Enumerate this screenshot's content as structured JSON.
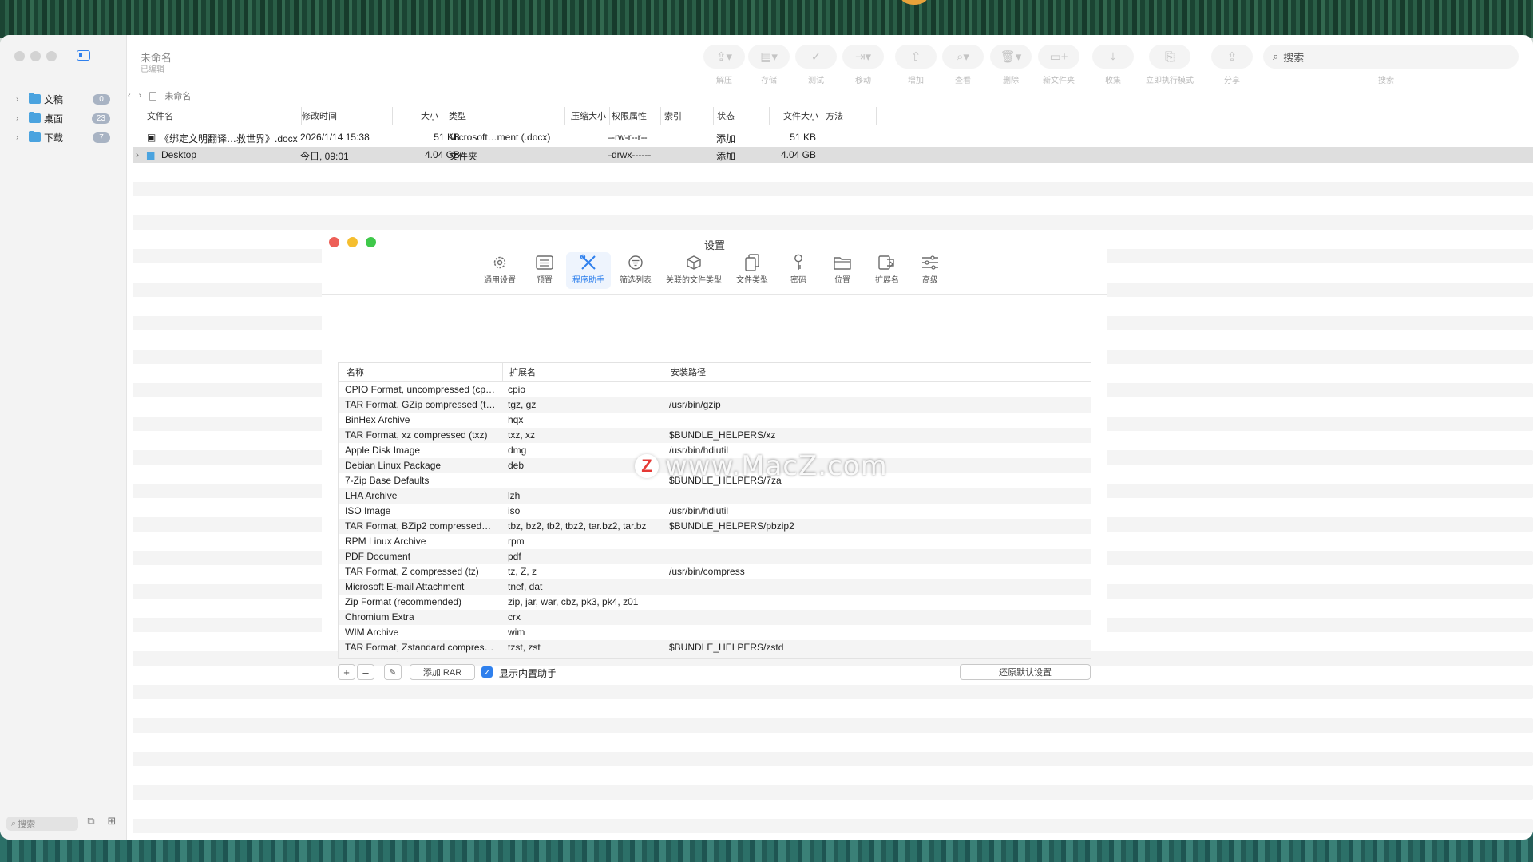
{
  "app": {
    "title": "未命名",
    "subtitle": "已编辑"
  },
  "sidebar": {
    "items": [
      {
        "label": "文稿",
        "count": "0"
      },
      {
        "label": "桌面",
        "count": "23"
      },
      {
        "label": "下载",
        "count": "7"
      }
    ],
    "search_placeholder": "搜索"
  },
  "toolbar": [
    {
      "label": "解压",
      "icon": "extract-icon"
    },
    {
      "label": "存储",
      "icon": "archive-icon"
    },
    {
      "label": "测试",
      "icon": "test-icon"
    },
    {
      "label": "移动",
      "icon": "move-icon"
    },
    {
      "label": "增加",
      "icon": "add-icon"
    },
    {
      "label": "查看",
      "icon": "view-icon"
    },
    {
      "label": "删除",
      "icon": "trash-icon"
    },
    {
      "label": "新文件夹",
      "icon": "new-folder-icon"
    },
    {
      "label": "收集",
      "icon": "collect-icon"
    },
    {
      "label": "立即执行模式",
      "icon": "run-mode-icon"
    },
    {
      "label": "分享",
      "icon": "share-icon"
    }
  ],
  "search": {
    "placeholder": "搜索",
    "label": "搜索"
  },
  "breadcrumb": {
    "item": "未命名"
  },
  "file_table": {
    "columns": [
      "文件名",
      "修改时间",
      "大小",
      "类型",
      "压缩大小",
      "权限属性",
      "索引",
      "状态",
      "文件大小",
      "方法"
    ],
    "rows": [
      {
        "name": "《绑定文明翻译…救世界》.docx",
        "modified": "2026/1/14 15:38",
        "size": "51 KB",
        "type": "Microsoft…ment (.docx)",
        "compressed": "–",
        "permissions": "-rw-r--r--",
        "index": "",
        "status": "添加",
        "file_size": "51 KB",
        "method": ""
      },
      {
        "name": "Desktop",
        "modified": "今日, 09:01",
        "size": "4.04 GB",
        "type": "文件夹",
        "compressed": "–",
        "permissions": "drwx------",
        "index": "",
        "status": "添加",
        "file_size": "4.04 GB",
        "method": ""
      }
    ]
  },
  "dialog": {
    "title": "设置",
    "tabs": [
      {
        "label": "通用设置",
        "icon": "gear-icon"
      },
      {
        "label": "预置",
        "icon": "list-icon"
      },
      {
        "label": "程序助手",
        "icon": "tools-icon"
      },
      {
        "label": "筛选列表",
        "icon": "filter-icon"
      },
      {
        "label": "关联的文件类型",
        "icon": "box-icon"
      },
      {
        "label": "文件类型",
        "icon": "documents-icon"
      },
      {
        "label": "密码",
        "icon": "key-icon"
      },
      {
        "label": "位置",
        "icon": "folder-icon"
      },
      {
        "label": "扩展名",
        "icon": "extension-icon"
      },
      {
        "label": "高级",
        "icon": "sliders-icon"
      }
    ],
    "active_tab": "程序助手",
    "table": {
      "columns": [
        "名称",
        "扩展名",
        "安装路径"
      ],
      "rows": [
        {
          "name": "CPIO Format, uncompressed (cp…",
          "ext": "cpio",
          "path": ""
        },
        {
          "name": "TAR Format, GZip compressed (t…",
          "ext": "tgz, gz",
          "path": "/usr/bin/gzip"
        },
        {
          "name": "BinHex Archive",
          "ext": "hqx",
          "path": ""
        },
        {
          "name": "TAR Format, xz compressed (txz)",
          "ext": "txz, xz",
          "path": "$BUNDLE_HELPERS/xz"
        },
        {
          "name": "Apple Disk Image",
          "ext": "dmg",
          "path": "/usr/bin/hdiutil"
        },
        {
          "name": "Debian Linux Package",
          "ext": "deb",
          "path": ""
        },
        {
          "name": "7-Zip Base Defaults",
          "ext": "",
          "path": "$BUNDLE_HELPERS/7za"
        },
        {
          "name": "LHA Archive",
          "ext": "lzh",
          "path": ""
        },
        {
          "name": "ISO Image",
          "ext": "iso",
          "path": "/usr/bin/hdiutil"
        },
        {
          "name": "TAR Format, BZip2 compressed…",
          "ext": "tbz, bz2, tb2, tbz2, tar.bz2, tar.bz",
          "path": "$BUNDLE_HELPERS/pbzip2"
        },
        {
          "name": "RPM Linux Archive",
          "ext": "rpm",
          "path": ""
        },
        {
          "name": "PDF Document",
          "ext": "pdf",
          "path": ""
        },
        {
          "name": "TAR Format, Z compressed (tz)",
          "ext": "tz, Z, z",
          "path": "/usr/bin/compress"
        },
        {
          "name": "Microsoft E-mail Attachment",
          "ext": "tnef, dat",
          "path": ""
        },
        {
          "name": "Zip Format (recommended)",
          "ext": "zip, jar, war, cbz, pk3, pk4, z01",
          "path": ""
        },
        {
          "name": "Chromium Extra",
          "ext": "crx",
          "path": ""
        },
        {
          "name": "WIM Archive",
          "ext": "wim",
          "path": ""
        },
        {
          "name": "TAR Format, Zstandard compres…",
          "ext": "tzst, zst",
          "path": "$BUNDLE_HELPERS/zstd"
        }
      ]
    },
    "buttons": {
      "add": "+",
      "remove": "–",
      "edit": "✎",
      "add_rar": "添加 RAR",
      "show_builtin": "显示内置助手",
      "restore": "还原默认设置"
    },
    "show_builtin_checked": true
  },
  "watermark": {
    "logo": "Z",
    "text": "www.MacZ.com"
  },
  "colors": {
    "accent": "#2f80ed",
    "close": "#ed5f57",
    "minimize": "#f5be2f",
    "zoom": "#3fc84a"
  }
}
